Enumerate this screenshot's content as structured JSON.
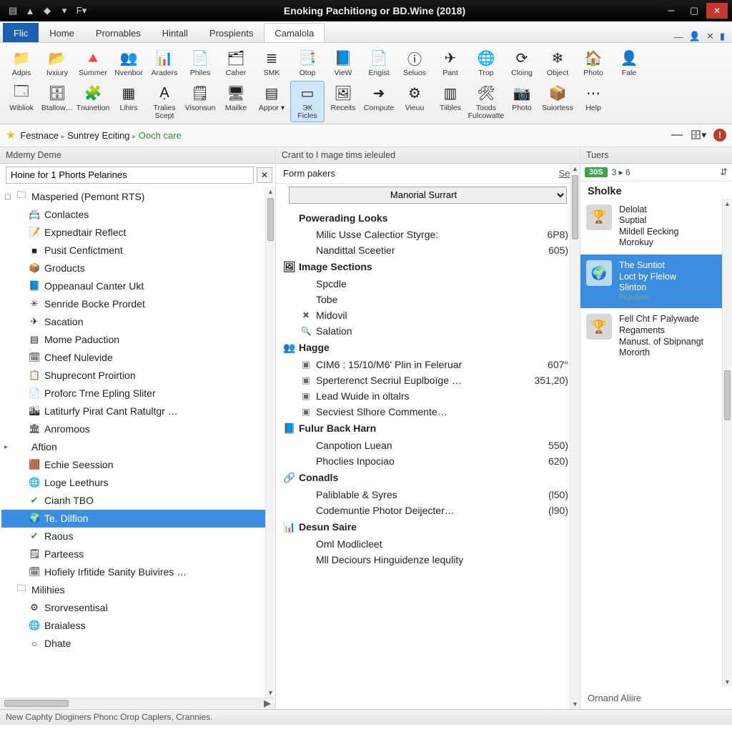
{
  "window": {
    "title": "Enoking Pachitiong or BD.Wine (2018)"
  },
  "tabs": {
    "file": "Flic",
    "items": [
      "Home",
      "Prornables",
      "Hintall",
      "Prospients",
      "Camalola"
    ],
    "active_index": 4
  },
  "ribbon": {
    "row1": [
      {
        "label": "Adpis",
        "icon": "📁"
      },
      {
        "label": "Ivxiury",
        "icon": "📂"
      },
      {
        "label": "Summer",
        "icon": "🔺"
      },
      {
        "label": "Nvenbor",
        "icon": "👥"
      },
      {
        "label": "Araders",
        "icon": "📊"
      },
      {
        "label": "Philes",
        "icon": "📄"
      },
      {
        "label": "Caher",
        "icon": "🗂"
      },
      {
        "label": "SMK",
        "icon": "≣"
      },
      {
        "label": "Otop",
        "icon": "📑"
      },
      {
        "label": "VieW",
        "icon": "📘"
      },
      {
        "label": "Engist",
        "icon": "📄"
      },
      {
        "label": "Seluos",
        "icon": "ⓘ"
      },
      {
        "label": "Pant",
        "icon": "✈"
      },
      {
        "label": "Trop",
        "icon": "🌐"
      },
      {
        "label": "Cloing",
        "icon": "⟳"
      },
      {
        "label": "Object",
        "icon": "❄"
      },
      {
        "label": "Photo",
        "icon": "🏠"
      },
      {
        "label": "Fale",
        "icon": "👤"
      }
    ],
    "row2": [
      {
        "label": "Wibliok",
        "icon": "🗔"
      },
      {
        "label": "Btallow…",
        "icon": "🗄"
      },
      {
        "label": "Tnunetion",
        "icon": "🧩"
      },
      {
        "label": "Lihirs",
        "icon": "▦"
      },
      {
        "label": "Tralies",
        "sub": "Scept",
        "icon": "Ạ"
      },
      {
        "label": "Visonsun",
        "icon": "🗒"
      },
      {
        "label": "Mailke",
        "icon": "🖥"
      },
      {
        "label": "Appor ▾",
        "icon": "▤"
      },
      {
        "label": "ЭК",
        "sub": "Ficles",
        "icon": "▭",
        "selected": true
      },
      {
        "label": "Receits",
        "icon": "🖼"
      },
      {
        "label": "Compute",
        "icon": "➜"
      },
      {
        "label": "Vieuu",
        "icon": "⚙"
      },
      {
        "label": "Tiibles",
        "icon": "▥"
      },
      {
        "label": "Toods",
        "sub": "Fulcowatte",
        "icon": "🛠"
      },
      {
        "label": "Photo",
        "icon": "📷"
      },
      {
        "label": "Suiortess",
        "icon": "📦"
      },
      {
        "label": "Help",
        "icon": "⋯"
      }
    ]
  },
  "breadcrumb": {
    "items": [
      "Festnace",
      "Suntrey Eciting",
      "Ooch care"
    ],
    "green_index": 2
  },
  "left": {
    "header": "Mdemy Deme",
    "search_value": "Hoine for 1 Phorts Pelarines",
    "nodes": [
      {
        "d": 0,
        "exp": "▢",
        "ic": "🗀",
        "t": "Masperied (Pemont RTS)"
      },
      {
        "d": 1,
        "ic": "📇",
        "t": "Conlactes"
      },
      {
        "d": 1,
        "ic": "📝",
        "t": "Expnedtair Reflect"
      },
      {
        "d": 1,
        "ic": "■",
        "t": "Pusit Cenfictment"
      },
      {
        "d": 1,
        "ic": "📦",
        "t": "Groducts"
      },
      {
        "d": 1,
        "ic": "📘",
        "t": "Oppeanaul Canter Ukt"
      },
      {
        "d": 1,
        "ic": "✳",
        "t": "Senride Bocke Prordet"
      },
      {
        "d": 1,
        "ic": "✈",
        "t": "Sacation"
      },
      {
        "d": 1,
        "ic": "▤",
        "t": "Mome Paduction"
      },
      {
        "d": 1,
        "ic": "🗓",
        "t": "Cheef Nulevide"
      },
      {
        "d": 1,
        "ic": "📋",
        "t": "Shuprecont Proirtion"
      },
      {
        "d": 1,
        "ic": "📄",
        "t": "Proforc Trne Epling Sliter"
      },
      {
        "d": 1,
        "ic": "🏙",
        "t": "Latiturfy Pirat Cant Ratultgr …"
      },
      {
        "d": 1,
        "ic": "🏛",
        "t": "Anromoos"
      },
      {
        "d": 0,
        "exp": "▸",
        "ic": "",
        "t": "Aftion",
        "link": true
      },
      {
        "d": 1,
        "ic": "🟫",
        "t": "Echie Seession"
      },
      {
        "d": 1,
        "ic": "🌐",
        "t": "Loge Leethurs"
      },
      {
        "d": 1,
        "ic": "✔",
        "t": "Cianh TBO",
        "green": true
      },
      {
        "d": 1,
        "ic": "🌍",
        "t": "Te. Dilfion",
        "sel": true
      },
      {
        "d": 1,
        "ic": "✔",
        "t": "Raous",
        "green": true
      },
      {
        "d": 1,
        "ic": "🗒",
        "t": "Parteess"
      },
      {
        "d": 1,
        "ic": "🗓",
        "t": "Hofiely Irfitide Sanity Buivires …"
      },
      {
        "d": 0,
        "exp": "",
        "ic": "🗀",
        "t": "Milihies"
      },
      {
        "d": 1,
        "ic": "⚙",
        "t": "Srorvesentisal"
      },
      {
        "d": 1,
        "ic": "🌐",
        "t": "Braialess"
      },
      {
        "d": 1,
        "ic": "○",
        "t": "Dhate"
      }
    ]
  },
  "mid": {
    "title": "Crant to I mage tims ieleuled",
    "form_label": "Form pakers",
    "set_label": "Set",
    "selector": "Manorial Surrart",
    "groups": [
      {
        "h": "Powerading Looks",
        "ic": "",
        "rows": [
          {
            "t": "Milic Usse Calectior Styrge:",
            "v": "6P8)"
          },
          {
            "t": "Nandittal Sceetier",
            "v": "605)"
          }
        ]
      },
      {
        "h": "Image Sections",
        "ic": "🖼",
        "rows": [
          {
            "t": "Spcdle"
          },
          {
            "t": "Tobe",
            "ic": ""
          },
          {
            "t": "Midovil",
            "ic": "✖"
          },
          {
            "t": "Salation",
            "ic": "🔍"
          }
        ]
      },
      {
        "h": "Hagge",
        "ic": "👥",
        "rows": [
          {
            "t": "CIM6 : 15/10/M6' Plin in Feleruar",
            "v": "607°",
            "ic": "▣"
          },
          {
            "t": "Sperterenct Secriul Euplboïge …",
            "v": "351,20)",
            "ic": "▣"
          },
          {
            "t": "Lead Wuide in oltalrs",
            "ic": "▣"
          },
          {
            "t": "Secviest Slhore Commente…",
            "ic": "▣"
          }
        ]
      },
      {
        "h": "Fulur Back Harn",
        "ic": "📘",
        "rows": [
          {
            "t": "Canpotion Luean",
            "v": "550)"
          },
          {
            "t": "Phoclies Inpociao",
            "v": "620)"
          }
        ]
      },
      {
        "h": "Conadls",
        "ic": "🔗",
        "rows": [
          {
            "t": "Paliblable & Syres",
            "v": "(l50)"
          },
          {
            "t": "Codemuntie Photor Deijecter…",
            "v": "(l90)"
          }
        ]
      },
      {
        "h": "Desun Saire",
        "ic": "📊",
        "rows": [
          {
            "t": "Oml Modlicleet"
          },
          {
            "t": "Mll Deciours Hinguidenze lequlity"
          }
        ]
      }
    ]
  },
  "right": {
    "header": "Tuers",
    "badge": "30S",
    "pager": "3 ▸ 6",
    "sort": "⇵",
    "section": "Sholke",
    "items": [
      {
        "lines": [
          "Delolat",
          "Suptial",
          "Mildell Eecking",
          "Morokuy"
        ],
        "cap": ""
      },
      {
        "lines": [
          "The Suntiot",
          "Loct by Flelow",
          "Slinton"
        ],
        "cap": "Pepoliver",
        "sel": true
      },
      {
        "lines": [
          "Fell Cht F Palywade",
          "Regaments",
          "Manust. of Sbipnangt",
          "Mororth"
        ],
        "cap": ""
      }
    ],
    "footer": "Ornand Aliire"
  },
  "status": {
    "text": "New Caphty Dioginers Phonc Orop Caplers, Crannies."
  }
}
